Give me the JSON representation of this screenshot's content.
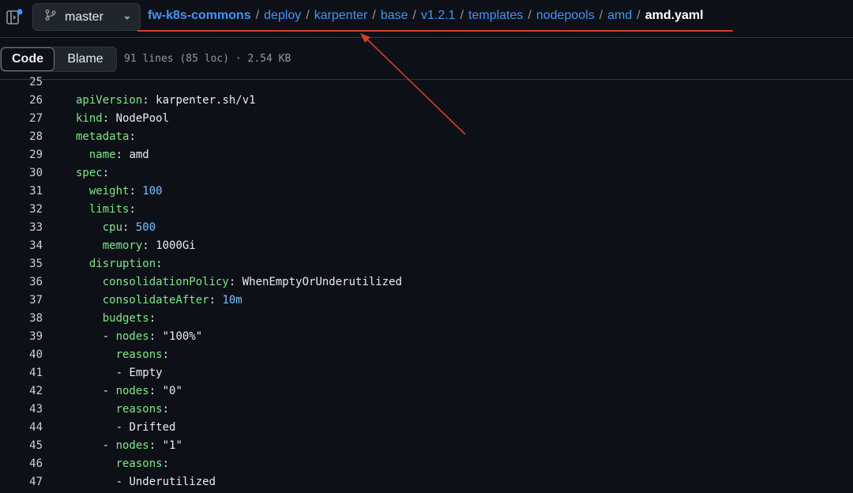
{
  "header": {
    "branch": "master",
    "breadcrumb": {
      "repo": "fw-k8s-commons",
      "parts": [
        "deploy",
        "karpenter",
        "base",
        "v1.2.1",
        "templates",
        "nodepools",
        "amd"
      ],
      "file": "amd.yaml",
      "separator": "/"
    }
  },
  "toolbar": {
    "code_label": "Code",
    "blame_label": "Blame",
    "file_info": "91 lines (85 loc) · 2.54 KB"
  },
  "code": {
    "lines": [
      {
        "num": "25",
        "indent": "",
        "key": "",
        "sep": "",
        "value": "",
        "value_type": "plain"
      },
      {
        "num": "26",
        "indent": "",
        "key": "apiVersion",
        "sep": ": ",
        "value": "karpenter.sh/v1",
        "value_type": "plain"
      },
      {
        "num": "27",
        "indent": "",
        "key": "kind",
        "sep": ": ",
        "value": "NodePool",
        "value_type": "plain"
      },
      {
        "num": "28",
        "indent": "",
        "key": "metadata",
        "sep": ":",
        "value": "",
        "value_type": "plain"
      },
      {
        "num": "29",
        "indent": "  ",
        "key": "name",
        "sep": ": ",
        "value": "amd",
        "value_type": "plain"
      },
      {
        "num": "30",
        "indent": "",
        "key": "spec",
        "sep": ":",
        "value": "",
        "value_type": "plain"
      },
      {
        "num": "31",
        "indent": "  ",
        "key": "weight",
        "sep": ": ",
        "value": "100",
        "value_type": "number"
      },
      {
        "num": "32",
        "indent": "  ",
        "key": "limits",
        "sep": ":",
        "value": "",
        "value_type": "plain"
      },
      {
        "num": "33",
        "indent": "    ",
        "key": "cpu",
        "sep": ": ",
        "value": "500",
        "value_type": "number"
      },
      {
        "num": "34",
        "indent": "    ",
        "key": "memory",
        "sep": ": ",
        "value": "1000Gi",
        "value_type": "plain"
      },
      {
        "num": "35",
        "indent": "  ",
        "key": "disruption",
        "sep": ":",
        "value": "",
        "value_type": "plain"
      },
      {
        "num": "36",
        "indent": "    ",
        "key": "consolidationPolicy",
        "sep": ": ",
        "value": "WhenEmptyOrUnderutilized",
        "value_type": "plain"
      },
      {
        "num": "37",
        "indent": "    ",
        "key": "consolidateAfter",
        "sep": ": ",
        "value": "10m",
        "value_type": "number"
      },
      {
        "num": "38",
        "indent": "    ",
        "key": "budgets",
        "sep": ":",
        "value": "",
        "value_type": "plain"
      },
      {
        "num": "39",
        "indent": "    - ",
        "key": "nodes",
        "sep": ": ",
        "value": "\"100%\"",
        "value_type": "plain"
      },
      {
        "num": "40",
        "indent": "      ",
        "key": "reasons",
        "sep": ":",
        "value": "",
        "value_type": "plain"
      },
      {
        "num": "41",
        "indent": "      - ",
        "key": "",
        "sep": "",
        "value": "Empty",
        "value_type": "plain"
      },
      {
        "num": "42",
        "indent": "    - ",
        "key": "nodes",
        "sep": ": ",
        "value": "\"0\"",
        "value_type": "plain"
      },
      {
        "num": "43",
        "indent": "      ",
        "key": "reasons",
        "sep": ":",
        "value": "",
        "value_type": "plain"
      },
      {
        "num": "44",
        "indent": "      - ",
        "key": "",
        "sep": "",
        "value": "Drifted",
        "value_type": "plain"
      },
      {
        "num": "45",
        "indent": "    - ",
        "key": "nodes",
        "sep": ": ",
        "value": "\"1\"",
        "value_type": "plain"
      },
      {
        "num": "46",
        "indent": "      ",
        "key": "reasons",
        "sep": ":",
        "value": "",
        "value_type": "plain"
      },
      {
        "num": "47",
        "indent": "      - ",
        "key": "",
        "sep": "",
        "value": "Underutilized",
        "value_type": "plain"
      }
    ]
  },
  "annotation": {
    "color": "#d0402a"
  },
  "colors": {
    "background": "#0d1117",
    "link": "#4493f8",
    "yaml_key": "#7ee787",
    "yaml_number": "#79c0ff"
  }
}
